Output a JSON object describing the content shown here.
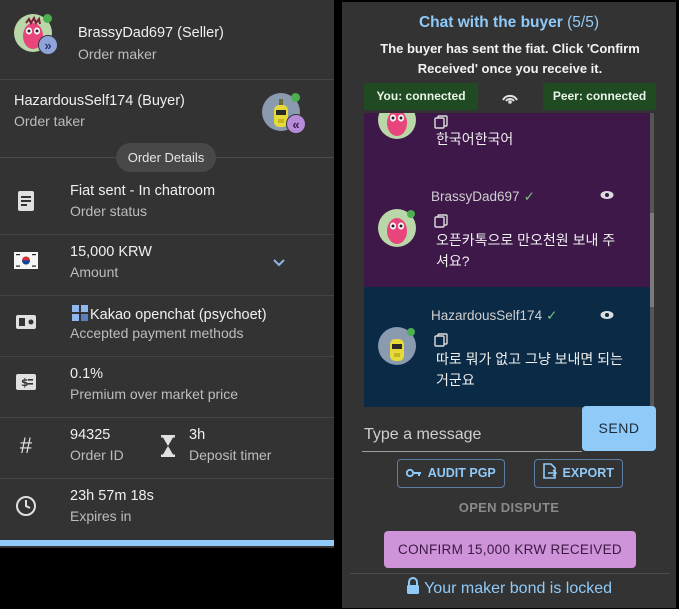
{
  "seller": {
    "name": "BrassyDad697 (Seller)",
    "role": "Order maker"
  },
  "buyer": {
    "name": "HazardousSelf174 (Buyer)",
    "role": "Order taker"
  },
  "order_details_label": "Order Details",
  "details": [
    {
      "icon": "receipt-icon",
      "value": "Fiat sent - In chatroom",
      "label": "Order status"
    },
    {
      "icon": "korea-flag-icon",
      "value": "15,000 KRW",
      "label": "Amount"
    },
    {
      "icon": "payment-icon",
      "value": "Kakao opechat (psychoet)",
      "label": "Accepted payment methods"
    },
    {
      "icon": "exchange-icon",
      "value": "0.1%",
      "label": "Premium over market price"
    },
    {
      "icon": "hash-icon",
      "value": "94325",
      "label": "Order ID"
    },
    {
      "icon": "clock-icon",
      "value": "23h 57m 18s",
      "label": "Expires in"
    }
  ],
  "payment_method_display": "Kakao openchat (psychoet)",
  "deposit": {
    "value": "3h",
    "label": "Deposit timer"
  },
  "chat": {
    "title": "Chat with the buyer",
    "count": "(5/5)",
    "info": "The buyer has sent the fiat. Click 'Confirm Received' once you receive it.",
    "you_status": "You: connected",
    "peer_status": "Peer: connected",
    "messages": [
      {
        "text": "한국어한국어"
      },
      {
        "author": "BrassyDad697",
        "text": "오픈카톡으로 만오천원 보내 주셔요?"
      },
      {
        "author": "HazardousSelf174",
        "text": "따로 뭐가 없고 그냥 보내면 되는거군요"
      }
    ],
    "placeholder": "Type a message",
    "send_label": "SEND",
    "audit_label": "AUDIT PGP",
    "export_label": "EXPORT",
    "dispute_label": "OPEN DISPUTE",
    "confirm_label": "CONFIRM 15,000 KRW RECEIVED",
    "bond_text": "Your maker bond is locked"
  },
  "colors": {
    "accent": "#90caf9",
    "confirm": "#ce93d8",
    "connected": "#1f4a22"
  }
}
